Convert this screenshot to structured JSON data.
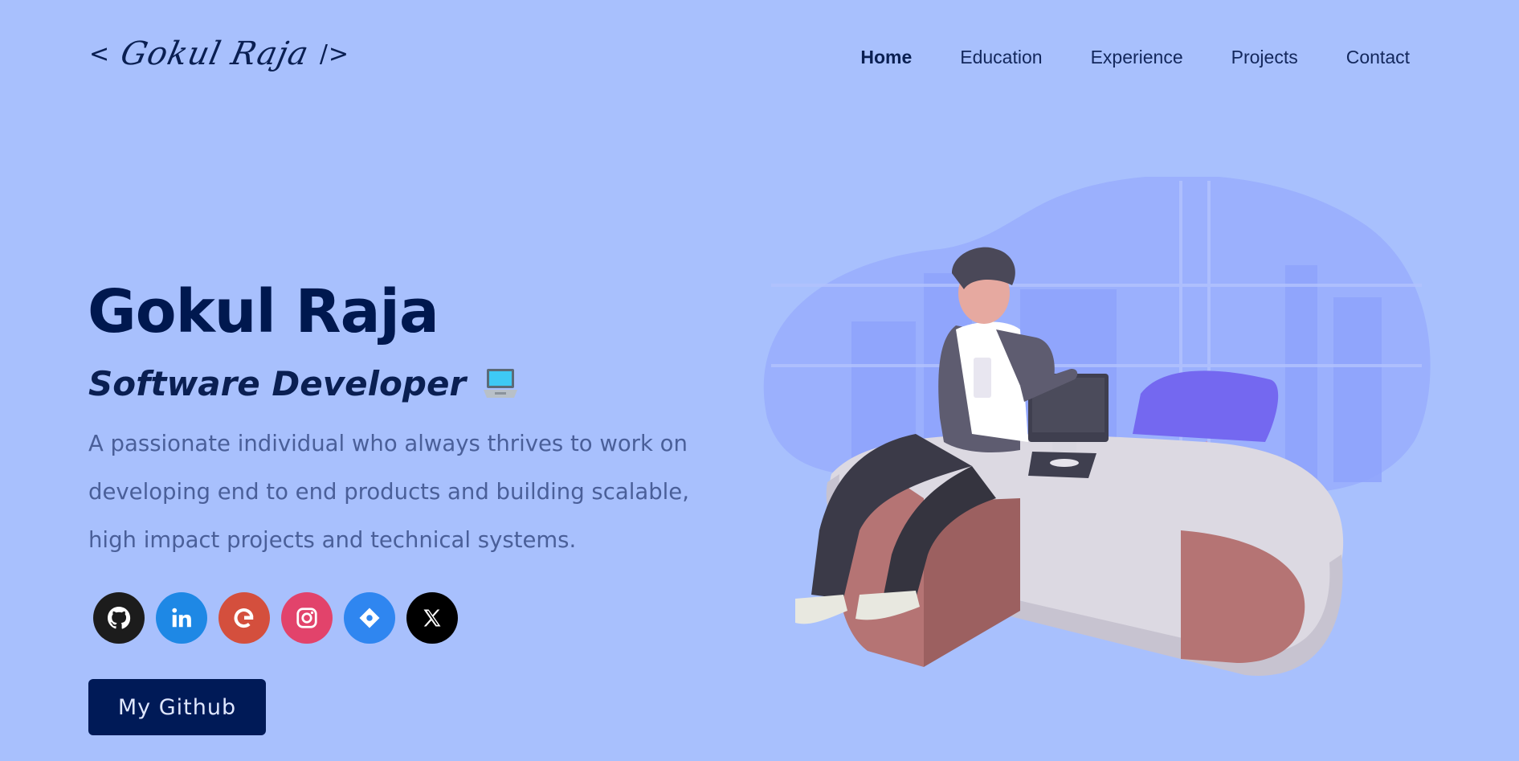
{
  "header": {
    "logo": {
      "open": "<",
      "name": "Gokul Raja",
      "close": "/>"
    },
    "nav": [
      {
        "label": "Home",
        "active": true
      },
      {
        "label": "Education",
        "active": false
      },
      {
        "label": "Experience",
        "active": false
      },
      {
        "label": "Projects",
        "active": false
      },
      {
        "label": "Contact",
        "active": false
      }
    ]
  },
  "hero": {
    "name": "Gokul Raja",
    "role": "Software Developer",
    "tagline": "A passionate individual who always thrives to work on developing end to end products and building scalable, high impact projects and technical systems.",
    "cta": "My Github"
  },
  "socials": [
    {
      "icon": "github-icon",
      "color": "#1c1c1c"
    },
    {
      "icon": "linkedin-icon",
      "color": "#1e88e5"
    },
    {
      "icon": "google-icon",
      "color": "#d44f3d"
    },
    {
      "icon": "instagram-icon",
      "color": "#e2436b"
    },
    {
      "icon": "medium-icon",
      "color": "#2f86f0"
    },
    {
      "icon": "x-icon",
      "color": "#000000"
    }
  ],
  "colors": {
    "background": "#a8c0fd",
    "primary": "#00184f",
    "muted": "#4a5f99"
  }
}
